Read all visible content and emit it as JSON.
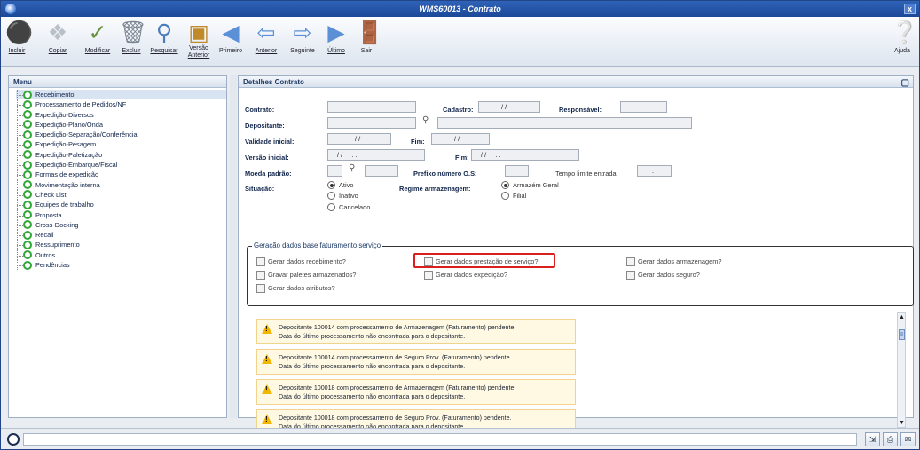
{
  "window": {
    "title": "WMS60013 - Contrato",
    "close_label": "x"
  },
  "toolbar": {
    "buttons": [
      {
        "label": "Incluir",
        "icon": "add-icon"
      },
      {
        "label": "Copiar",
        "icon": "copy-icon"
      },
      {
        "label": "Modificar",
        "icon": "edit-icon"
      },
      {
        "label": "Excluir",
        "icon": "trash-icon"
      },
      {
        "label": "Pesquisar",
        "icon": "search-icon"
      },
      {
        "label": "Versão Anterior",
        "icon": "previous-version-icon"
      },
      {
        "label": "Primeiro",
        "icon": "first-icon"
      },
      {
        "label": "Anterior",
        "icon": "previous-icon"
      },
      {
        "label": "Seguinte",
        "icon": "next-icon"
      },
      {
        "label": "Último",
        "icon": "last-icon"
      },
      {
        "label": "Sair",
        "icon": "exit-icon"
      }
    ],
    "help_label": "Ajuda"
  },
  "menu": {
    "title": "Menu",
    "items": [
      {
        "label": "Recebimento",
        "selected": true
      },
      {
        "label": "Processamento de Pedidos/NF"
      },
      {
        "label": "Expedição-Diversos"
      },
      {
        "label": "Expedição-Plano/Onda"
      },
      {
        "label": "Expedição-Separação/Conferência"
      },
      {
        "label": "Expedição-Pesagem"
      },
      {
        "label": "Expedição-Paletização"
      },
      {
        "label": "Expedição-Embarque/Fiscal"
      },
      {
        "label": "Formas de expedição"
      },
      {
        "label": "Movimentação interna"
      },
      {
        "label": "Check List"
      },
      {
        "label": "Equipes de trabalho"
      },
      {
        "label": "Proposta"
      },
      {
        "label": "Cross-Docking"
      },
      {
        "label": "Recall"
      },
      {
        "label": "Ressuprimento"
      },
      {
        "label": "Outros"
      },
      {
        "label": "Pendências"
      }
    ]
  },
  "details": {
    "title": "Detalhes Contrato",
    "contrato_label": "Contrato:",
    "contrato_value": "",
    "cadastro_label": "Cadastro:",
    "cadastro_value": "/ /",
    "responsavel_label": "Responsável:",
    "responsavel_value": "",
    "depositante_label": "Depositante:",
    "validade_label": "Validade inicial:",
    "validade_value": "/ /",
    "fim_label": "Fim:",
    "fim_value": "/ /",
    "versao_label": "Versão inicial:",
    "versao_value": "/ /     : :",
    "versao_fim_label": "Fim:",
    "versao_fim_value": "/ /     : :",
    "moeda_label": "Moeda padrão:",
    "prefixo_label": "Prefixo número O.S:",
    "tempo_label": "Tempo limite entrada:",
    "tempo_value": ":",
    "situacao_label": "Situação:",
    "situacao_options": [
      "Ativo",
      "Inativo",
      "Cancelado"
    ],
    "situacao_selected": "Ativo",
    "regime_label": "Regime armazenagem:",
    "regime_options": [
      "Armazém Geral",
      "Filial"
    ],
    "regime_selected": "Armazém Geral"
  },
  "billing": {
    "legend": "Geração dados base faturamento serviço",
    "checkboxes": [
      "Gerar dados recebimento?",
      "Gravar paletes armazenados?",
      "Gerar dados atributos?",
      "Gerar dados prestação de serviço?",
      "Gerar dados expedição?",
      "Gerar dados armazenagem?",
      "Gerar dados seguro?"
    ]
  },
  "messages": [
    {
      "line1": "Depositante 100014 com processamento de Armazenagem (Faturamento) pendente.",
      "line2": "Data do último processamento não encontrada para o depositante."
    },
    {
      "line1": "Depositante 100014 com processamento de Seguro Prov. (Faturamento) pendente.",
      "line2": "Data do último processamento não encontrada para o depositante."
    },
    {
      "line1": "Depositante 100018 com processamento de Armazenagem (Faturamento) pendente.",
      "line2": "Data do último processamento não encontrada para o depositante."
    },
    {
      "line1": "Depositante 100018 com processamento de Seguro Prov. (Faturamento) pendente.",
      "line2": "Data do último processamento não encontrada para o depositante."
    }
  ],
  "colors": {
    "titlebar": "#1c4899",
    "highlight": "#d9201f",
    "menu_bullet": "#2fa836",
    "message_bg": "#fff8e3"
  }
}
